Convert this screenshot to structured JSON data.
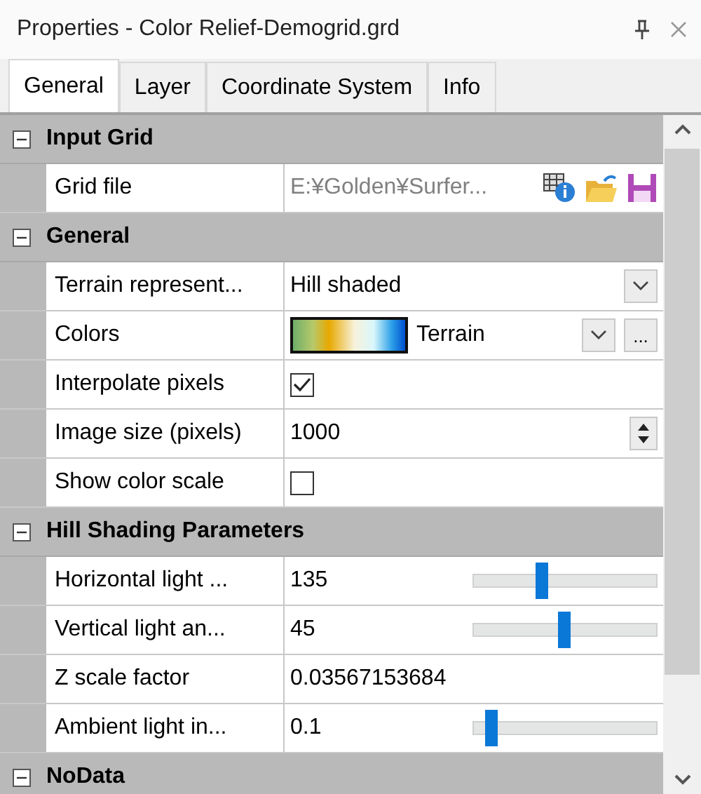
{
  "window": {
    "title": "Properties - Color Relief-Demogrid.grd"
  },
  "tabs": [
    {
      "label": "General",
      "selected": true
    },
    {
      "label": "Layer",
      "selected": false
    },
    {
      "label": "Coordinate System",
      "selected": false
    },
    {
      "label": "Info",
      "selected": false
    }
  ],
  "sections": [
    {
      "title": "Input Grid",
      "expanded": true,
      "rows": [
        {
          "kind": "file",
          "label": "Grid file",
          "value": "E:¥Golden¥Surfer..."
        }
      ]
    },
    {
      "title": "General",
      "expanded": true,
      "rows": [
        {
          "kind": "dropdown",
          "label": "Terrain represent...",
          "value": "Hill shaded"
        },
        {
          "kind": "colormap",
          "label": "Colors",
          "value": "Terrain",
          "button": "..."
        },
        {
          "kind": "checkbox",
          "label": "Interpolate pixels",
          "checked": true
        },
        {
          "kind": "spin",
          "label": "Image size (pixels)",
          "value": "1000"
        },
        {
          "kind": "checkbox",
          "label": "Show color scale",
          "checked": false
        }
      ]
    },
    {
      "title": "Hill Shading Parameters",
      "expanded": true,
      "rows": [
        {
          "kind": "slider",
          "label": "Horizontal light ...",
          "value": "135",
          "level": 0.375
        },
        {
          "kind": "slider",
          "label": "Vertical light an...",
          "value": "45",
          "level": 0.5
        },
        {
          "kind": "text",
          "label": "Z scale factor",
          "value": "0.03567153684"
        },
        {
          "kind": "slider",
          "label": "Ambient light in...",
          "value": "0.1",
          "level": 0.1
        }
      ]
    },
    {
      "title": "NoData",
      "expanded": true
    }
  ]
}
